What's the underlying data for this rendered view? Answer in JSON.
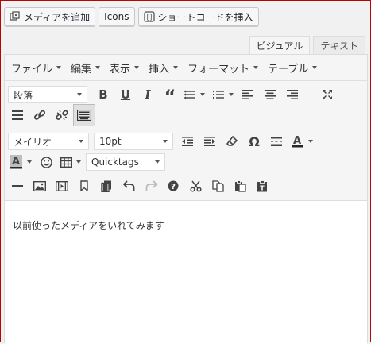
{
  "top_buttons": {
    "add_media": "メディアを追加",
    "icons": "Icons",
    "shortcode": "ショートコードを挿入"
  },
  "tabs": {
    "visual": "ビジュアル",
    "text": "テキスト"
  },
  "menubar": [
    "ファイル",
    "編集",
    "表示",
    "挿入",
    "フォーマット",
    "テーブル"
  ],
  "toolbar": {
    "format_select": "段落",
    "font_family": "メイリオ",
    "font_size": "10pt",
    "quicktags": "Quicktags"
  },
  "content": {
    "text": "以前使ったメディアをいれてみます"
  },
  "colors": {
    "frame_border": "#7a1f1f",
    "text_color_underline": "#23282d"
  }
}
